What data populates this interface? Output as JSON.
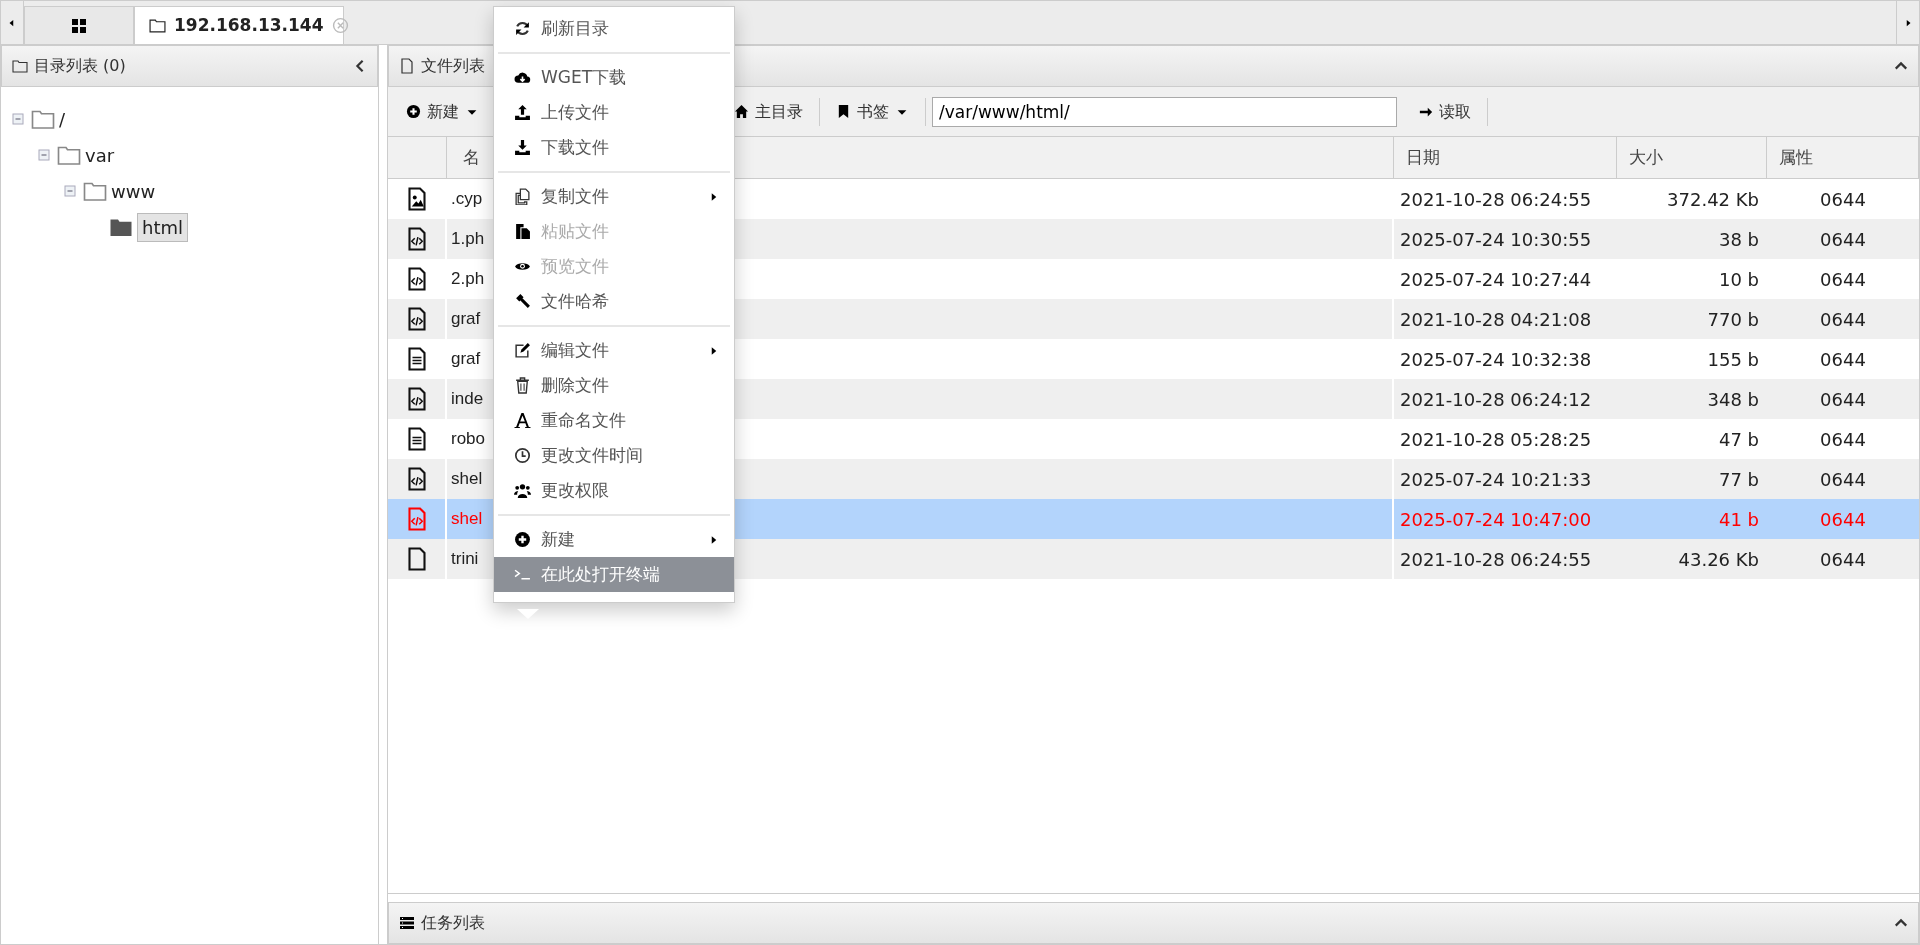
{
  "tabs": [
    {
      "kind": "home",
      "selected": false
    },
    {
      "kind": "host",
      "label": "192.168.13.144",
      "selected": true
    }
  ],
  "dir_panel": {
    "title": "目录列表 (0)",
    "tree": [
      {
        "label": "/",
        "selected": false,
        "children": [
          {
            "label": "var",
            "selected": false,
            "children": [
              {
                "label": "www",
                "selected": false,
                "children": [
                  {
                    "label": "html",
                    "selected": true
                  }
                ]
              }
            ]
          }
        ]
      }
    ]
  },
  "file_panel": {
    "title": "文件列表",
    "toolbar": [
      {
        "kind": "new",
        "label": "新建",
        "dropdown": true
      },
      {
        "kind": "home",
        "label": "主目录",
        "dropdown": false
      },
      {
        "kind": "bookmark",
        "label": "书签",
        "dropdown": true
      }
    ],
    "path": "/var/www/html/",
    "read_button": "读取",
    "columns": [
      "名",
      "日期",
      "大小",
      "属性"
    ],
    "rows": [
      {
        "kind": "image",
        "name": ".cyp",
        "date": "2021-10-28 06:24:55",
        "size": "372.42 Kb",
        "attr": "0644",
        "selected": false
      },
      {
        "kind": "code",
        "name": "1.ph",
        "date": "2025-07-24 10:30:55",
        "size": "38 b",
        "attr": "0644",
        "selected": false
      },
      {
        "kind": "code",
        "name": "2.ph",
        "date": "2025-07-24 10:27:44",
        "size": "10 b",
        "attr": "0644",
        "selected": false
      },
      {
        "kind": "code",
        "name": "graf",
        "date": "2021-10-28 04:21:08",
        "size": "770 b",
        "attr": "0644",
        "selected": false
      },
      {
        "kind": "text",
        "name": "graf",
        "date": "2025-07-24 10:32:38",
        "size": "155 b",
        "attr": "0644",
        "selected": false
      },
      {
        "kind": "code",
        "name": "inde",
        "date": "2021-10-28 06:24:12",
        "size": "348 b",
        "attr": "0644",
        "selected": false
      },
      {
        "kind": "text",
        "name": "robo",
        "date": "2021-10-28 05:28:25",
        "size": "47 b",
        "attr": "0644",
        "selected": false
      },
      {
        "kind": "code",
        "name": "shel",
        "date": "2025-07-24 10:21:33",
        "size": "77 b",
        "attr": "0644",
        "selected": false
      },
      {
        "kind": "code",
        "name": "shel",
        "date": "2025-07-24 10:47:00",
        "size": "41 b",
        "attr": "0644",
        "selected": true
      },
      {
        "kind": "blank",
        "name": "trini",
        "date": "2021-10-28 06:24:55",
        "size": "43.26 Kb",
        "attr": "0644",
        "selected": false
      }
    ]
  },
  "context_menu": [
    {
      "kind": "item",
      "label": "刷新目录",
      "disabled": false,
      "submenu": false,
      "selected": false
    },
    {
      "kind": "separator"
    },
    {
      "kind": "item",
      "label": "WGET下载",
      "disabled": false,
      "submenu": false,
      "selected": false
    },
    {
      "kind": "item",
      "label": "上传文件",
      "disabled": false,
      "submenu": false,
      "selected": false
    },
    {
      "kind": "item",
      "label": "下载文件",
      "disabled": false,
      "submenu": false,
      "selected": false
    },
    {
      "kind": "separator"
    },
    {
      "kind": "item",
      "label": "复制文件",
      "disabled": false,
      "submenu": true,
      "selected": false
    },
    {
      "kind": "item",
      "label": "粘贴文件",
      "disabled": true,
      "submenu": false,
      "selected": false
    },
    {
      "kind": "item",
      "label": "预览文件",
      "disabled": true,
      "submenu": false,
      "selected": false
    },
    {
      "kind": "item",
      "label": "文件哈希",
      "disabled": false,
      "submenu": false,
      "selected": false
    },
    {
      "kind": "separator"
    },
    {
      "kind": "item",
      "label": "编辑文件",
      "disabled": false,
      "submenu": true,
      "selected": false
    },
    {
      "kind": "item",
      "label": "删除文件",
      "disabled": false,
      "submenu": false,
      "selected": false
    },
    {
      "kind": "item",
      "label": "重命名文件",
      "disabled": false,
      "submenu": false,
      "selected": false
    },
    {
      "kind": "item",
      "label": "更改文件时间",
      "disabled": false,
      "submenu": false,
      "selected": false
    },
    {
      "kind": "item",
      "label": "更改权限",
      "disabled": false,
      "submenu": false,
      "selected": false
    },
    {
      "kind": "separator"
    },
    {
      "kind": "item",
      "label": "新建",
      "disabled": false,
      "submenu": true,
      "selected": false
    },
    {
      "kind": "item",
      "label": "在此处打开终端",
      "disabled": false,
      "submenu": false,
      "selected": true
    }
  ],
  "task_panel": {
    "title": "任务列表"
  }
}
